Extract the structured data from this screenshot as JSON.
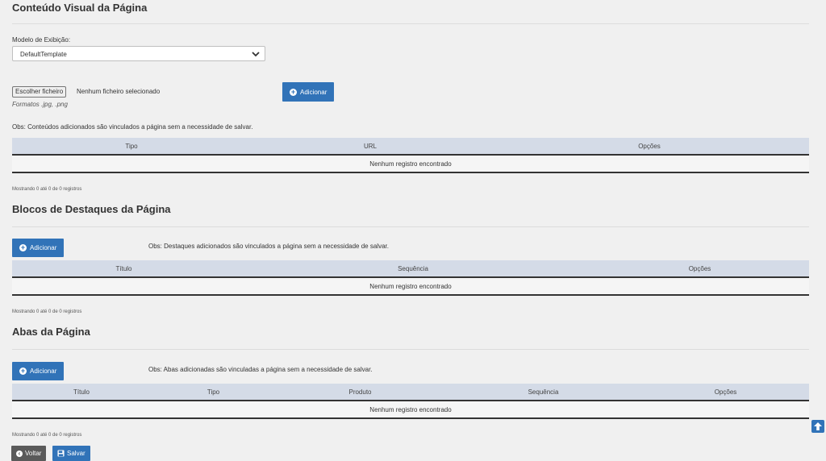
{
  "visual": {
    "title": "Conteúdo Visual da Página",
    "model_label": "Modelo de Exibição:",
    "model_value": "DefaultTemplate",
    "file_button": "Escolher ficheiro",
    "file_status": "Nenhum ficheiro selecionado",
    "formats_hint": "Formatos .jpg, .png",
    "add_button": "Adicionar",
    "obs": "Obs: Conteúdos adicionados são vinculados a página sem a necessidade de salvar.",
    "columns": [
      "Tipo",
      "URL",
      "Opções"
    ],
    "empty": "Nenhum registro encontrado",
    "count": "Mostrando 0 até 0 de 0 registros"
  },
  "highlights": {
    "title": "Blocos de Destaques da Página",
    "add_button": "Adicionar",
    "obs": "Obs: Destaques adicionados são vinculados a página sem a necessidade de salvar.",
    "columns": [
      "Título",
      "Sequência",
      "Opções"
    ],
    "empty": "Nenhum registro encontrado",
    "count": "Mostrando 0 até 0 de 0 registros"
  },
  "tabs": {
    "title": "Abas da Página",
    "add_button": "Adicionar",
    "obs": "Obs: Abas adicionadas são vinculadas a página sem a necessidade de salvar.",
    "columns": [
      "Título",
      "Tipo",
      "Produto",
      "Sequência",
      "Opções"
    ],
    "empty": "Nenhum registro encontrado",
    "count": "Mostrando 0 até 0 de 0 registros"
  },
  "footer": {
    "back_button": "Voltar",
    "save_button": "Salvar"
  },
  "colors": {
    "primary": "#3173b8",
    "header_row": "#d4dbe7",
    "back": "#5a5a5a"
  },
  "icons": [
    "chevron-down-icon",
    "plus-circle-icon",
    "save-icon",
    "arrow-up-icon"
  ]
}
